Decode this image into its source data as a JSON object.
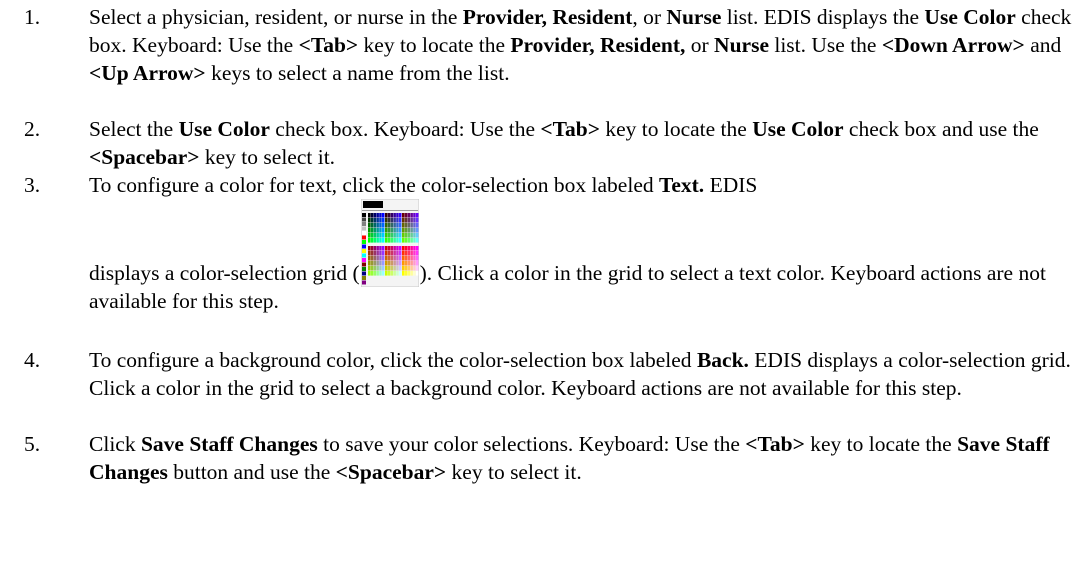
{
  "steps": [
    {
      "number": "1.",
      "runs": [
        {
          "t": "Select a physician, resident, or nurse in the "
        },
        {
          "t": "Provider, Resident",
          "b": true
        },
        {
          "t": ", or "
        },
        {
          "t": "Nurse",
          "b": true
        },
        {
          "t": " list. EDIS displays the "
        },
        {
          "t": "Use Color",
          "b": true
        },
        {
          "t": " check box. Keyboard: Use the "
        },
        {
          "t": "<Tab>",
          "b": true
        },
        {
          "t": " key to locate the "
        },
        {
          "t": "Provider, Resident,",
          "b": true
        },
        {
          "t": " or "
        },
        {
          "t": "Nurse",
          "b": true
        },
        {
          "t": " list. Use the "
        },
        {
          "t": "<Down Arrow>",
          "b": true
        },
        {
          "t": " and "
        },
        {
          "t": "<Up Arrow>",
          "b": true
        },
        {
          "t": " keys to select a name from the list."
        }
      ]
    },
    {
      "number": "2.",
      "runs": [
        {
          "t": "Select the "
        },
        {
          "t": "Use Color",
          "b": true
        },
        {
          "t": " check box. Keyboard: Use the "
        },
        {
          "t": "<Tab>",
          "b": true
        },
        {
          "t": " key to locate the "
        },
        {
          "t": "Use Color",
          "b": true
        },
        {
          "t": " check box and use the "
        },
        {
          "t": "<Spacebar>",
          "b": true
        },
        {
          "t": " key to select it."
        }
      ]
    },
    {
      "number": "3.",
      "runs": [
        {
          "t": "To configure a color for text, click the color-selection box labeled "
        },
        {
          "t": "Text.",
          "b": true
        },
        {
          "t": " EDIS"
        },
        {
          "br": true
        },
        {
          "t": "displays a color-selection grid ("
        },
        {
          "img": "color-selection-grid"
        },
        {
          "t": "). Click a color in the grid to select a text color. Keyboard actions are not available for this step."
        }
      ]
    },
    {
      "number": "4.",
      "runs": [
        {
          "t": "To configure a background color, click the color-selection box labeled "
        },
        {
          "t": "Back.",
          "b": true
        },
        {
          "t": " EDIS displays a color-selection grid. Click a color in the grid to select a background color. Keyboard actions are not available for this step."
        }
      ]
    },
    {
      "number": "5.",
      "runs": [
        {
          "t": "Click "
        },
        {
          "t": "Save Staff Changes",
          "b": true
        },
        {
          "t": " to save your color selections. Keyboard: Use the "
        },
        {
          "t": "<Tab>",
          "b": true
        },
        {
          "t": " key to locate the "
        },
        {
          "t": "Save Staff Changes",
          "b": true
        },
        {
          "t": " button and use the "
        },
        {
          "t": "<Spacebar>",
          "b": true
        },
        {
          "t": " key to select it."
        }
      ]
    }
  ]
}
